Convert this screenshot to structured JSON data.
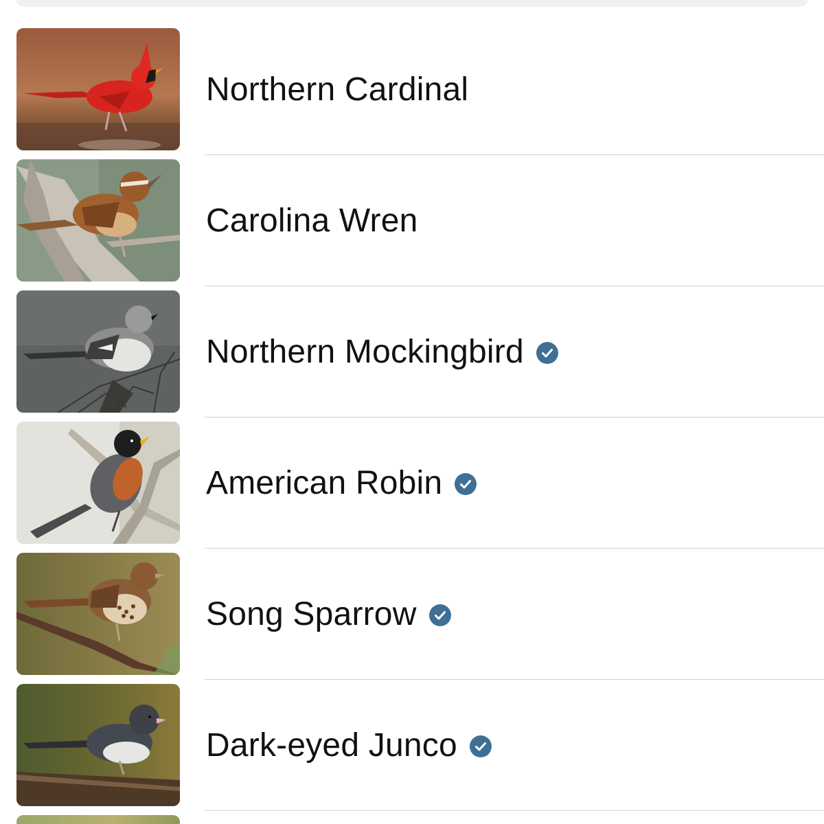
{
  "birds": [
    {
      "name": "Northern Cardinal",
      "verified": false,
      "thumbnail_icon": "northern-cardinal-photo"
    },
    {
      "name": "Carolina Wren",
      "verified": false,
      "thumbnail_icon": "carolina-wren-photo"
    },
    {
      "name": "Northern Mockingbird",
      "verified": true,
      "thumbnail_icon": "northern-mockingbird-photo"
    },
    {
      "name": "American Robin",
      "verified": true,
      "thumbnail_icon": "american-robin-photo"
    },
    {
      "name": "Song Sparrow",
      "verified": true,
      "thumbnail_icon": "song-sparrow-photo"
    },
    {
      "name": "Dark-eyed Junco",
      "verified": true,
      "thumbnail_icon": "dark-eyed-junco-photo"
    }
  ],
  "colors": {
    "verified_badge": "#3f6f95",
    "divider": "#d2d2d6",
    "text": "#111111"
  }
}
